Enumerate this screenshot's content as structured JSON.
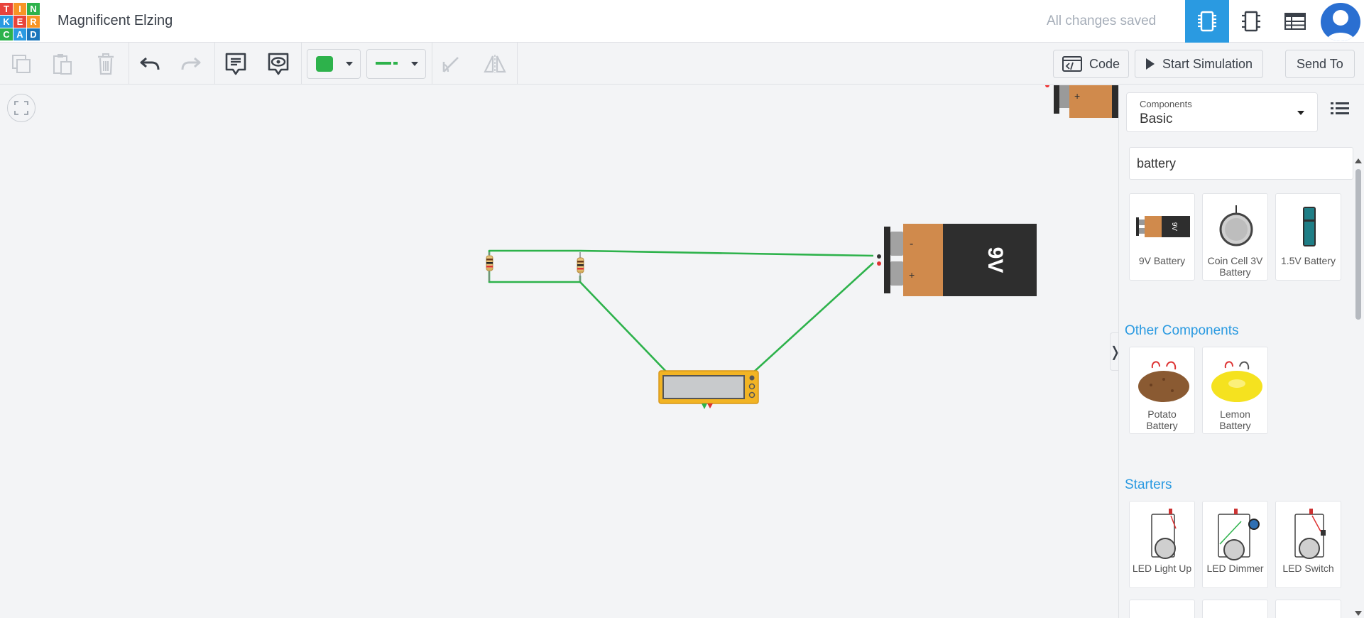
{
  "app": {
    "logo_letters": [
      "T",
      "I",
      "N",
      "K",
      "E",
      "R",
      "C",
      "A",
      "D"
    ],
    "logo_colors": [
      "#e8433b",
      "#f79425",
      "#2db24b",
      "#2a9ae1",
      "#e8433b",
      "#f79425",
      "#2db24b",
      "#2a9ae1",
      "#1a75bb"
    ],
    "project_title": "Magnificent Elzing",
    "save_status": "All changes saved",
    "accent_color": "#2a9ae1"
  },
  "toolbar": {
    "code_label": "Code",
    "start_simulation_label": "Start Simulation",
    "send_to_label": "Send To",
    "wire_color": "#2db24b"
  },
  "circuit": {
    "battery_label": "9V",
    "wire_color": "#2db24b"
  },
  "panel": {
    "components_label": "Components",
    "components_value": "Basic",
    "search_value": "battery",
    "sections": [
      {
        "title": "",
        "items": [
          {
            "name": "9V Battery"
          },
          {
            "name": "Coin Cell 3V Battery"
          },
          {
            "name": "1.5V Battery"
          }
        ]
      },
      {
        "title": "Other Components",
        "items": [
          {
            "name": "Potato Battery"
          },
          {
            "name": "Lemon Battery"
          }
        ]
      },
      {
        "title": "Starters",
        "items": [
          {
            "name": "LED Light Up"
          },
          {
            "name": "LED Dimmer"
          },
          {
            "name": "LED Switch"
          }
        ]
      }
    ]
  }
}
